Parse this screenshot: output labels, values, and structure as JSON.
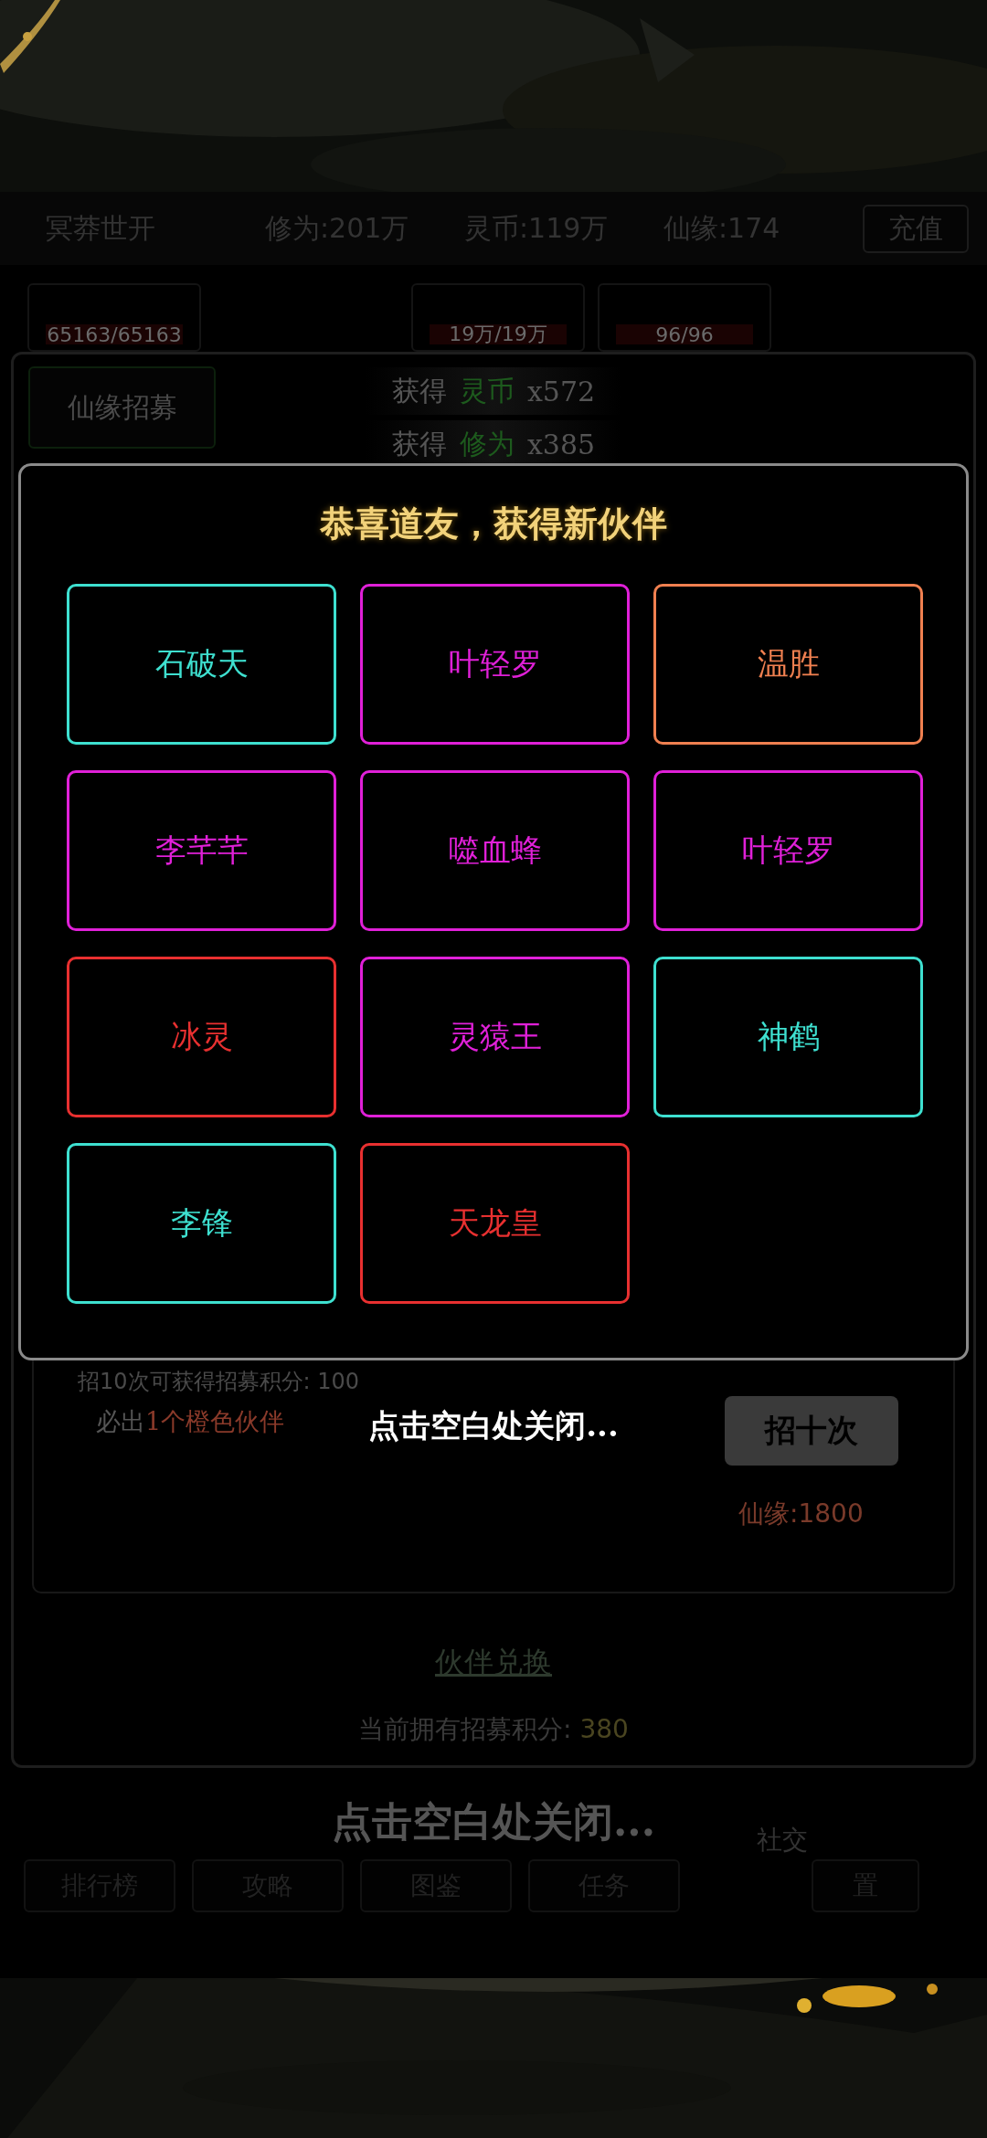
{
  "header": {
    "title": "冥莽世开",
    "stats": [
      "修为:201万",
      "灵币:119万",
      "仙缘:174"
    ],
    "recharge_button": "充值"
  },
  "resource_cards": [
    {
      "value": "65163/65163",
      "level": 1
    },
    {
      "value": "19万/19万",
      "level": 1
    },
    {
      "value": "96/96",
      "level": 1
    }
  ],
  "recruit_panel": {
    "tab": "仙缘招募",
    "rewards": [
      {
        "prefix": "获得",
        "item": "灵币",
        "amount": "x572"
      },
      {
        "prefix": "获得",
        "item": "修为",
        "amount": "x385"
      }
    ],
    "ten_pull": {
      "info": "招10次可获得招募积分: 100",
      "guarantee_prefix": "必出",
      "guarantee_highlight": "1个橙色伙伴",
      "button": "招十次",
      "cost": "仙缘:1800"
    },
    "exchange_link": "伙伴兑换",
    "points_label": "当前拥有招募积分: ",
    "points_value": "380"
  },
  "background_close_hint": "点击空白处关闭...",
  "nav": [
    "排行榜",
    "攻略",
    "图鉴",
    "任务",
    "社交",
    "置"
  ],
  "modal": {
    "title": "恭喜道友，获得新伙伴",
    "partners": [
      {
        "name": "石破天",
        "color": "#3ee0d0"
      },
      {
        "name": "叶轻罗",
        "color": "#e020d8"
      },
      {
        "name": "温胜",
        "color": "#f08050"
      },
      {
        "name": "李芊芊",
        "color": "#e020d8"
      },
      {
        "name": "噬血蜂",
        "color": "#e020d8"
      },
      {
        "name": "叶轻罗",
        "color": "#e020d8"
      },
      {
        "name": "冰灵",
        "color": "#e83030"
      },
      {
        "name": "灵猿王",
        "color": "#e020d8"
      },
      {
        "name": "神鹤",
        "color": "#3ee0d0"
      },
      {
        "name": "李锋",
        "color": "#3ee0d0"
      },
      {
        "name": "天龙皇",
        "color": "#e83030"
      }
    ],
    "close_hint": "点击空白处关闭..."
  }
}
